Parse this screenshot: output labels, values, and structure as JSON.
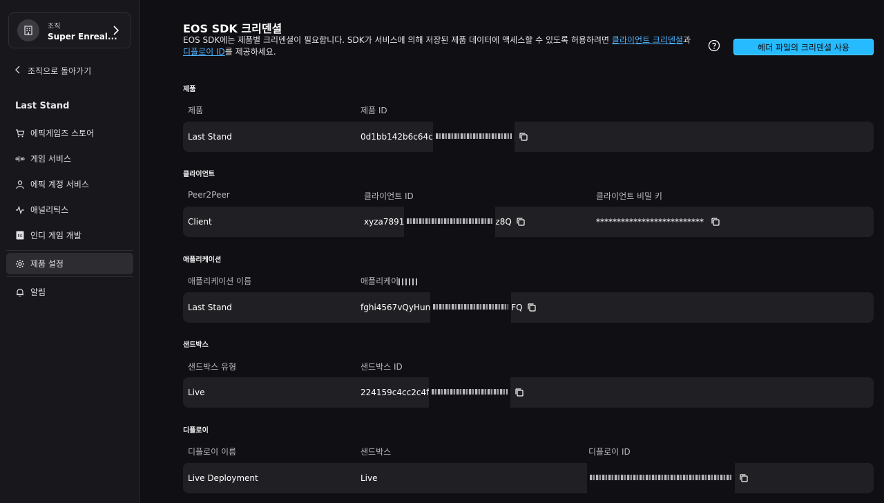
{
  "sidebar": {
    "org_label": "조직",
    "org_name": "Super Enreal...",
    "back_label": "조직으로 돌아가기",
    "project_name": "Last Stand",
    "items": [
      {
        "label": "에픽게임즈 스토어",
        "icon": "cart-icon"
      },
      {
        "label": "게임 서비스",
        "icon": "services-icon"
      },
      {
        "label": "에픽 계정 서비스",
        "icon": "user-icon"
      },
      {
        "label": "애널리틱스",
        "icon": "analytics-icon"
      },
      {
        "label": "인디 게임 개발",
        "icon": "indie-icon"
      },
      {
        "label": "제품 설정",
        "icon": "gear-icon",
        "active": true
      },
      {
        "label": "알림",
        "icon": "bell-icon"
      }
    ]
  },
  "header": {
    "title": "EOS SDK 크리덴셜",
    "desc_pre": "EOS SDK에는 제품별 크리덴셜이 필요합니다. SDK가 서비스에 의해 저장된 제품 데이터에 액세스할 수 있도록 허용하려면 ",
    "desc_link1": "클라이언트 크리덴셜",
    "desc_mid": "과 ",
    "desc_link2": "디플로이 ID",
    "desc_post": "를 제공하세요.",
    "button_label": "헤더 파일의 크리덴셜 사용"
  },
  "sections": {
    "product": {
      "label": "제품",
      "col1": "제품",
      "col2": "제품 ID",
      "name": "Last Stand",
      "id_prefix": "0d1bb142b6c64c"
    },
    "client": {
      "label": "클라이언트",
      "col1": "Peer2Peer",
      "col2": "클라이언트 ID",
      "col3": "클라이언트 비밀 키",
      "name": "Client",
      "id_prefix": "xyza7891",
      "id_suffix": "z8Q",
      "secret": "**************************"
    },
    "application": {
      "label": "애플리케이션",
      "col1": "애플리케이션 이름",
      "col2": "애플리케이",
      "name": "Last Stand",
      "id_prefix": "fghi4567vQyHun",
      "id_suffix": "FQ"
    },
    "sandbox": {
      "label": "샌드박스",
      "col1": "샌드박스 유형",
      "col2": "샌드박스 ID",
      "name": "Live",
      "id_prefix": "224159c4cc2c4f"
    },
    "deployment": {
      "label": "디플로이",
      "col1": "디플로이 이름",
      "col2": "샌드박스",
      "col3": "디플로이 ID",
      "name": "Live Deployment",
      "sandbox": "Live"
    }
  },
  "colors": {
    "accent": "#26bbff",
    "link": "#4fb3ff",
    "background": "#101014",
    "row": "#202024"
  }
}
